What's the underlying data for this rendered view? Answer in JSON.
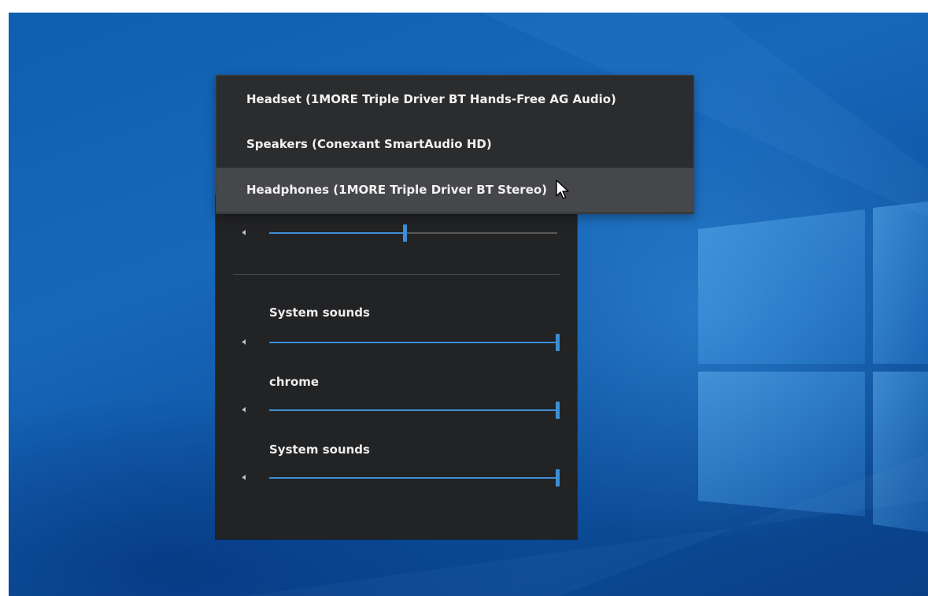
{
  "desktop": {
    "background_color": "#1366b7"
  },
  "device_dropdown": {
    "options": [
      {
        "label": "Headset (1MORE Triple Driver BT Hands-Free AG Audio)"
      },
      {
        "label": "Speakers (Conexant SmartAudio HD)"
      },
      {
        "label": "Headphones (1MORE Triple Driver BT Stereo)"
      }
    ],
    "highlighted_option": 2
  },
  "volume_mixer": {
    "device_volume": {
      "icon": "speaker-icon",
      "level_percent": 47
    },
    "apps": [
      {
        "name": "System sounds",
        "icon": "speaker-icon",
        "level_percent": 100
      },
      {
        "name": "chrome",
        "icon": "speaker-icon",
        "level_percent": 100
      },
      {
        "name": "System sounds",
        "icon": "speaker-icon",
        "level_percent": 100
      }
    ]
  },
  "colors": {
    "accent": "#3c8fd6",
    "panel": "#222325",
    "menu": "#2b2c2e",
    "menu_highlight": "#46474a"
  }
}
